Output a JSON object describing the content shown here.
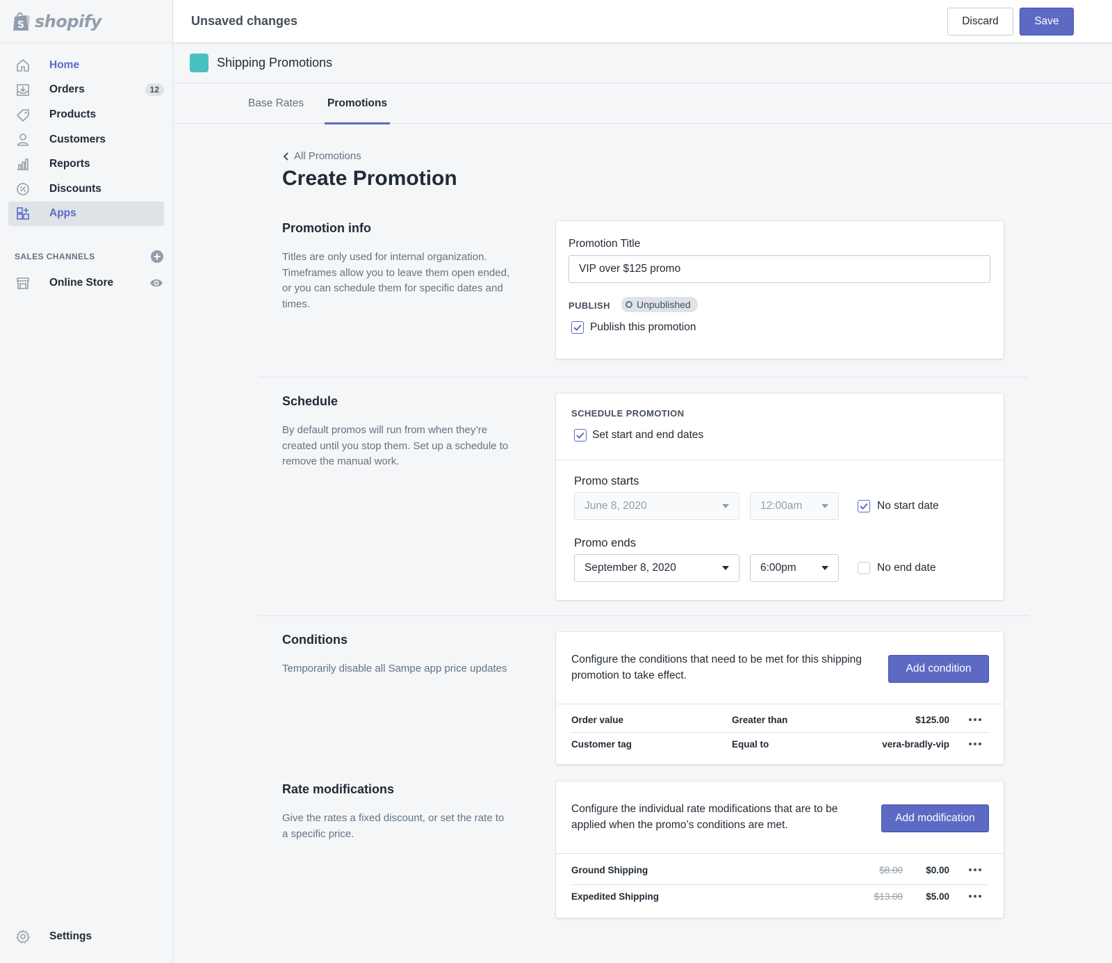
{
  "brand": {
    "logo_text": "shopify"
  },
  "sidebar": {
    "items": [
      {
        "label": "Home"
      },
      {
        "label": "Orders",
        "badge": "12"
      },
      {
        "label": "Products"
      },
      {
        "label": "Customers"
      },
      {
        "label": "Reports"
      },
      {
        "label": "Discounts"
      },
      {
        "label": "Apps"
      }
    ],
    "sales_channels_label": "SALES CHANNELS",
    "online_store": "Online Store",
    "settings": "Settings"
  },
  "topbar": {
    "title": "Unsaved changes",
    "discard": "Discard",
    "save": "Save"
  },
  "app": {
    "name": "Shipping Promotions",
    "accent": "#47c1bf"
  },
  "tabs": [
    {
      "label": "Base Rates"
    },
    {
      "label": "Promotions"
    }
  ],
  "page": {
    "back": "All Promotions",
    "title": "Create Promotion"
  },
  "promotion_info": {
    "title": "Promotion info",
    "description": "Titles are only used for internal organization.  Timeframes allow you to leave them open ended, or you can schedule them for specific dates and times.",
    "field_label": "Promotion Title",
    "field_value": "VIP over $125 promo",
    "publish_label": "PUBLISH",
    "status": "Unpublished",
    "publish_checkbox": "Publish this promotion"
  },
  "schedule": {
    "title": "Schedule",
    "description": "By default promos will run from when they’re created until you stop them.  Set up a schedule to remove the manual work.",
    "caps_label": "SCHEDULE PROMOTION",
    "set_dates": "Set start and end dates",
    "starts_label": "Promo starts",
    "start_date": "June 8, 2020",
    "start_time": "12:00am",
    "no_start": "No start date",
    "ends_label": "Promo ends",
    "end_date": "September 8, 2020",
    "end_time": "6:00pm",
    "no_end": "No end date"
  },
  "conditions": {
    "title": "Conditions",
    "description": "Temporarily disable all Sampe app price updates",
    "card_text": "Configure the conditions that need to be met for this shipping promotion to take effect.",
    "button": "Add condition",
    "rows": [
      {
        "field": "Order value",
        "operator": "Greater than",
        "value": "$125.00"
      },
      {
        "field": "Customer tag",
        "operator": "Equal to",
        "value": "vera-bradly-vip"
      }
    ]
  },
  "rate_modifications": {
    "title": "Rate modifications",
    "description": "Give the rates a fixed discount, or set the rate to a specific price.",
    "card_text": "Configure the individual rate modifications that are to be applied when the promo’s conditions are met.",
    "button": "Add modification",
    "rows": [
      {
        "name": "Ground Shipping",
        "old": "$8.00",
        "new": "$0.00"
      },
      {
        "name": "Expedited Shipping",
        "old": "$13.00",
        "new": "$5.00"
      }
    ]
  },
  "colors": {
    "primary": "#5c6ac4",
    "sidebar_bg": "#f4f6f8"
  }
}
